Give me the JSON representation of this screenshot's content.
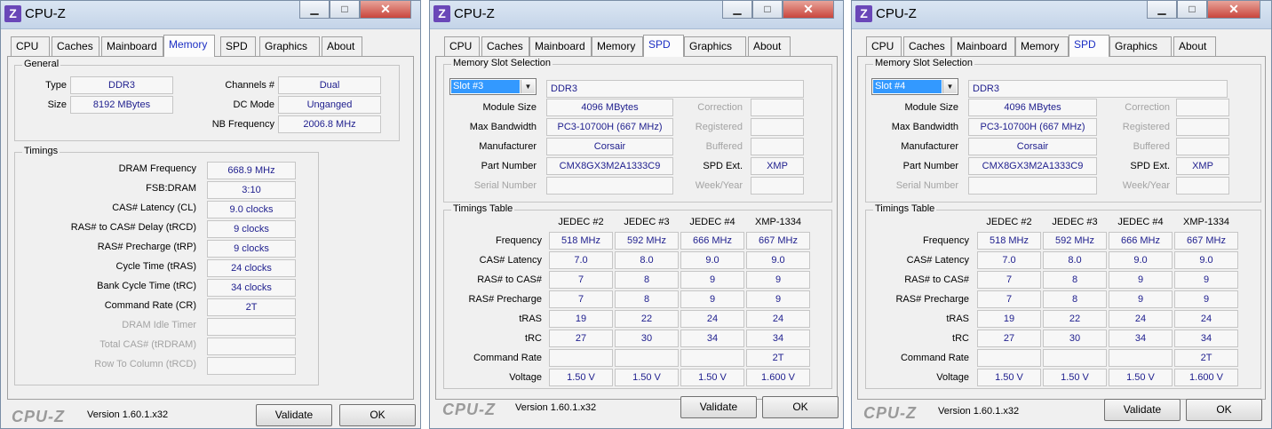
{
  "app": {
    "title": "CPU-Z",
    "icon_letter": "Z",
    "minimize": "▁",
    "maximize": "□",
    "close": "✕",
    "tabs": [
      "CPU",
      "Caches",
      "Mainboard",
      "Memory",
      "SPD",
      "Graphics",
      "About"
    ],
    "brand": "CPU-Z",
    "version": "Version 1.60.1.x32",
    "validate": "Validate",
    "ok": "OK"
  },
  "memory_tab": {
    "general": {
      "title": "General",
      "type_label": "Type",
      "type_value": "DDR3",
      "size_label": "Size",
      "size_value": "8192 MBytes",
      "channels_label": "Channels #",
      "channels_value": "Dual",
      "dcmode_label": "DC Mode",
      "dcmode_value": "Unganged",
      "nbfreq_label": "NB Frequency",
      "nbfreq_value": "2006.8 MHz"
    },
    "timings": {
      "title": "Timings",
      "rows": [
        {
          "label": "DRAM Frequency",
          "value": "668.9 MHz"
        },
        {
          "label": "FSB:DRAM",
          "value": "3:10"
        },
        {
          "label": "CAS# Latency (CL)",
          "value": "9.0 clocks"
        },
        {
          "label": "RAS# to CAS# Delay (tRCD)",
          "value": "9 clocks"
        },
        {
          "label": "RAS# Precharge (tRP)",
          "value": "9 clocks"
        },
        {
          "label": "Cycle Time (tRAS)",
          "value": "24 clocks"
        },
        {
          "label": "Bank Cycle Time (tRC)",
          "value": "34 clocks"
        },
        {
          "label": "Command Rate (CR)",
          "value": "2T"
        },
        {
          "label": "DRAM Idle Timer",
          "value": ""
        },
        {
          "label": "Total CAS# (tRDRAM)",
          "value": ""
        },
        {
          "label": "Row To Column (tRCD)",
          "value": ""
        }
      ]
    }
  },
  "spd_labels": {
    "slot_group": "Memory Slot Selection",
    "module_size": "Module Size",
    "max_bandwidth": "Max Bandwidth",
    "manufacturer": "Manufacturer",
    "part_number": "Part Number",
    "serial_number": "Serial Number",
    "correction": "Correction",
    "registered": "Registered",
    "buffered": "Buffered",
    "spd_ext": "SPD Ext.",
    "week_year": "Week/Year",
    "timings_group": "Timings Table",
    "columns": [
      "JEDEC #2",
      "JEDEC #3",
      "JEDEC #4",
      "XMP-1334"
    ],
    "rows": [
      "Frequency",
      "CAS# Latency",
      "RAS# to CAS#",
      "RAS# Precharge",
      "tRAS",
      "tRC",
      "Command Rate",
      "Voltage"
    ]
  },
  "spd_slot3": {
    "slot": "Slot #3",
    "type": "DDR3",
    "module_size": "4096 MBytes",
    "max_bandwidth": "PC3-10700H (667 MHz)",
    "manufacturer": "Corsair",
    "part_number": "CMX8GX3M2A1333C9",
    "serial_number": "",
    "spd_ext": "XMP",
    "timings": [
      [
        "518 MHz",
        "592 MHz",
        "666 MHz",
        "667 MHz"
      ],
      [
        "7.0",
        "8.0",
        "9.0",
        "9.0"
      ],
      [
        "7",
        "8",
        "9",
        "9"
      ],
      [
        "7",
        "8",
        "9",
        "9"
      ],
      [
        "19",
        "22",
        "24",
        "24"
      ],
      [
        "27",
        "30",
        "34",
        "34"
      ],
      [
        "",
        "",
        "",
        "2T"
      ],
      [
        "1.50 V",
        "1.50 V",
        "1.50 V",
        "1.600 V"
      ]
    ]
  },
  "spd_slot4": {
    "slot": "Slot #4",
    "type": "DDR3",
    "module_size": "4096 MBytes",
    "max_bandwidth": "PC3-10700H (667 MHz)",
    "manufacturer": "Corsair",
    "part_number": "CMX8GX3M2A1333C9",
    "serial_number": "",
    "spd_ext": "XMP",
    "timings": [
      [
        "518 MHz",
        "592 MHz",
        "666 MHz",
        "667 MHz"
      ],
      [
        "7.0",
        "8.0",
        "9.0",
        "9.0"
      ],
      [
        "7",
        "8",
        "9",
        "9"
      ],
      [
        "7",
        "8",
        "9",
        "9"
      ],
      [
        "19",
        "22",
        "24",
        "24"
      ],
      [
        "27",
        "30",
        "34",
        "34"
      ],
      [
        "",
        "",
        "",
        "2T"
      ],
      [
        "1.50 V",
        "1.50 V",
        "1.50 V",
        "1.600 V"
      ]
    ]
  }
}
